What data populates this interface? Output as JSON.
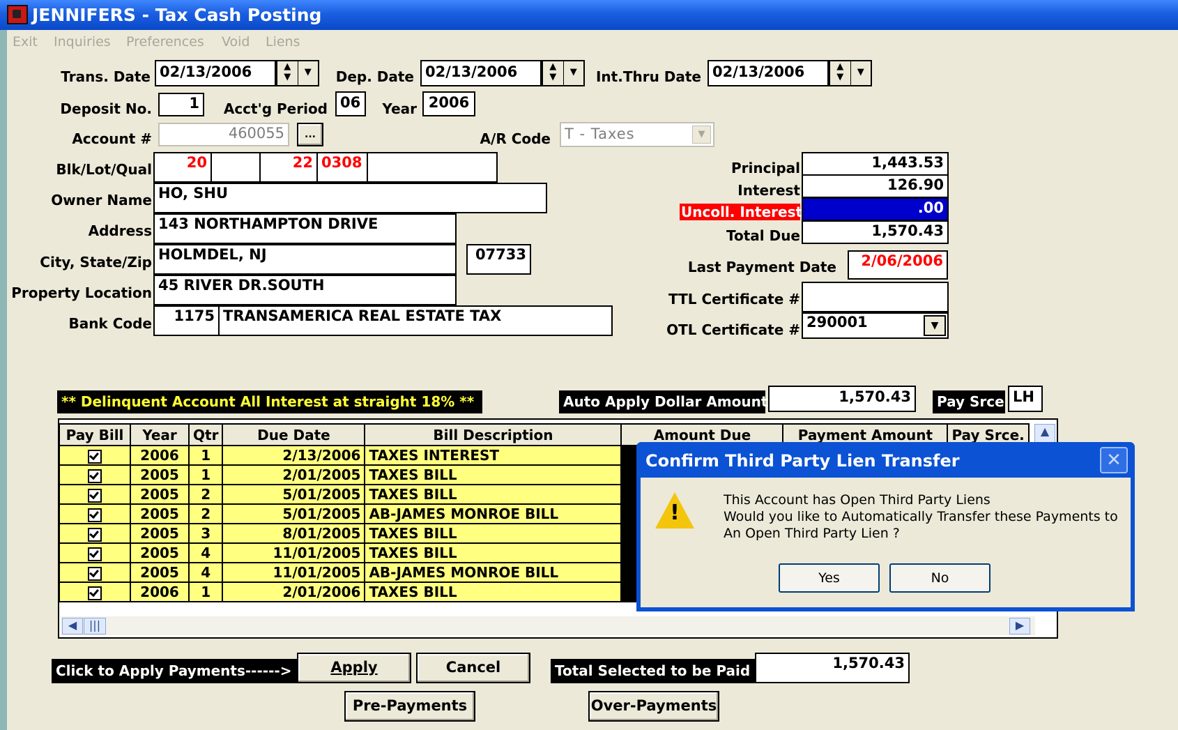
{
  "window": {
    "title": "JENNIFERS - Tax Cash Posting"
  },
  "menu": [
    "Exit",
    "Inquiries",
    "Preferences",
    "Void",
    "Liens"
  ],
  "form": {
    "trans_date_label": "Trans. Date",
    "trans_date": "02/13/2006",
    "dep_date_label": "Dep. Date",
    "dep_date": "02/13/2006",
    "int_thru_label": "Int.Thru Date",
    "int_thru_date": "02/13/2006",
    "deposit_no_label": "Deposit No.",
    "deposit_no": "1",
    "acct_period_label": "Acct'g Period",
    "acct_period": "06",
    "year_label": "Year",
    "year": "2006",
    "account_label": "Account #",
    "account": "460055",
    "browse_label": "...",
    "ar_code_label": "A/R Code",
    "ar_code": "T - Taxes",
    "blk_label": "Blk/Lot/Qual",
    "blk": [
      "20",
      "",
      "22",
      "0308",
      ""
    ],
    "owner_label": "Owner Name",
    "owner": "HO, SHU",
    "address_label": "Address",
    "address": "143 NORTHAMPTON DRIVE",
    "city_label": "City, State/Zip",
    "city": "HOLMDEL, NJ",
    "zip": "07733",
    "location_label": "Property Location",
    "location": "45 RIVER DR.SOUTH",
    "bank_label": "Bank Code",
    "bank_code": "1175",
    "bank_name": "TRANSAMERICA REAL ESTATE TAX"
  },
  "summary": {
    "principal_label": "Principal",
    "principal": "1,443.53",
    "interest_label": "Interest",
    "interest": "126.90",
    "uncoll_label": "Uncoll. Interest",
    "uncoll": ".00",
    "total_label": "Total Due",
    "total": "1,570.43",
    "last_payment_label": "Last Payment Date",
    "last_payment": "2/06/2006",
    "ttl_label": "TTL Certificate #",
    "ttl": "",
    "otl_label": "OTL Certificate #",
    "otl": "290001"
  },
  "notice": "** Delinquent Account All Interest at straight 18% **",
  "auto_apply": {
    "label": "Auto Apply Dollar Amount",
    "value": "1,570.43",
    "pay_srce_label": "Pay Srce",
    "pay_srce": "LH"
  },
  "table": {
    "headers": [
      "Pay Bill",
      "Year",
      "Qtr",
      "Due Date",
      "Bill Description",
      "Amount Due",
      "Payment Amount",
      "Pay Srce."
    ],
    "rows": [
      {
        "year": "2006",
        "qtr": "1",
        "due": "2/13/2006",
        "desc": "TAXES INTEREST"
      },
      {
        "year": "2005",
        "qtr": "1",
        "due": "2/01/2005",
        "desc": "TAXES BILL"
      },
      {
        "year": "2005",
        "qtr": "2",
        "due": "5/01/2005",
        "desc": "TAXES BILL"
      },
      {
        "year": "2005",
        "qtr": "2",
        "due": "5/01/2005",
        "desc": "AB-JAMES MONROE BILL"
      },
      {
        "year": "2005",
        "qtr": "3",
        "due": "8/01/2005",
        "desc": "TAXES BILL"
      },
      {
        "year": "2005",
        "qtr": "4",
        "due": "11/01/2005",
        "desc": "TAXES BILL"
      },
      {
        "year": "2005",
        "qtr": "4",
        "due": "11/01/2005",
        "desc": "AB-JAMES MONROE BILL"
      },
      {
        "year": "2006",
        "qtr": "1",
        "due": "2/01/2006",
        "desc": "TAXES BILL"
      }
    ]
  },
  "footer": {
    "apply_prompt": "Click to Apply Payments------>",
    "apply": "Apply",
    "cancel": "Cancel",
    "total_selected_label": "Total Selected to be Paid",
    "total_selected": "1,570.43",
    "pre_payments": "Pre-Payments",
    "over_payments": "Over-Payments"
  },
  "dialog": {
    "title": "Confirm Third Party Lien Transfer",
    "lines": [
      "This Account has Open Third Party Liens",
      "Would you like to Automatically Transfer these Payments to",
      "An Open Third Party Lien ?"
    ],
    "yes": "Yes",
    "no": "No"
  }
}
